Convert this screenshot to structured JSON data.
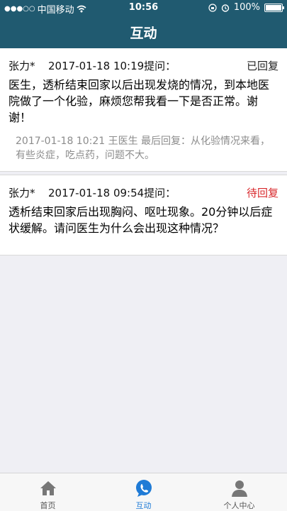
{
  "status_bar": {
    "carrier": "中国移动",
    "time": "10:56",
    "battery": "100%"
  },
  "header": {
    "title": "互动"
  },
  "questions": [
    {
      "name": "张力*",
      "time": "2017-01-18 10:19提问：",
      "status": "已回复",
      "text": "医生，透析结束回家以后出现发烧的情况，到本地医院做了一个化验，麻烦您帮我看一下是否正常。谢谢！",
      "reply": "2017-01-18   10:21  王医生  最后回复：从化验情况来看，有些炎症，吃点药，问题不大。"
    },
    {
      "name": "张力*",
      "time": "2017-01-18 09:54提问：",
      "status": "待回复",
      "text": "透析结束回家后出现胸闷、呕吐现象。20分钟以后症状缓解。请问医生为什么会出现这种情况？"
    }
  ],
  "tabbar": {
    "items": [
      {
        "label": "首页",
        "icon": "home-icon"
      },
      {
        "label": "互动",
        "icon": "chat-bubble-icon"
      },
      {
        "label": "个人中心",
        "icon": "person-icon"
      }
    ]
  },
  "colors": {
    "header": "#205a70",
    "accent": "#1f7bd6",
    "pending": "#d8282c"
  }
}
